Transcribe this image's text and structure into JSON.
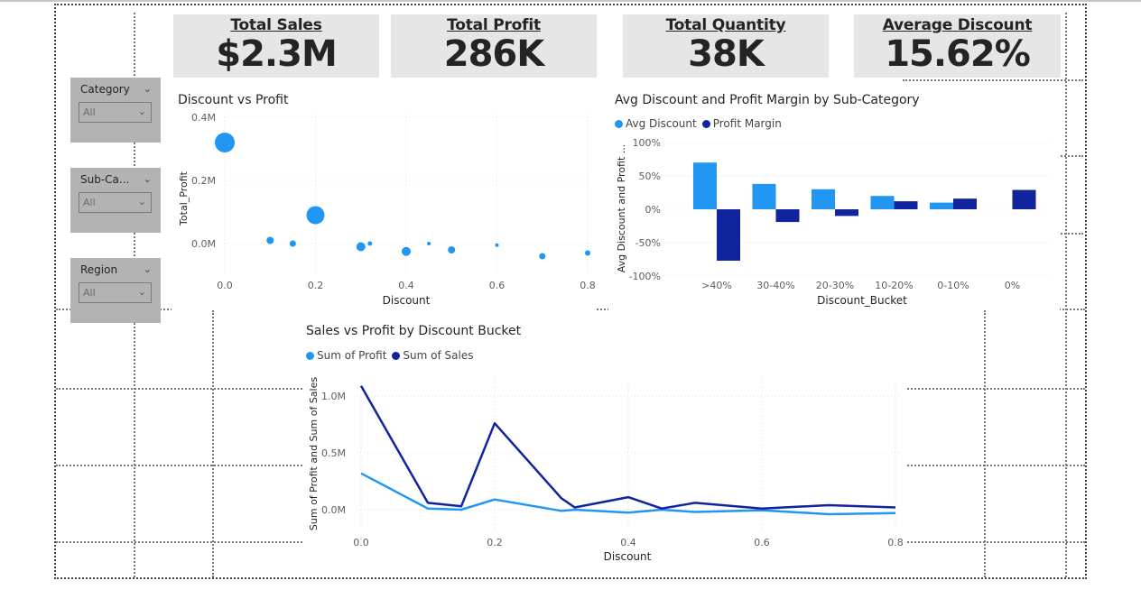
{
  "cards": [
    {
      "title": "Total Sales",
      "value": "$2.3M"
    },
    {
      "title": "Total Profit",
      "value": "286K"
    },
    {
      "title": "Total Quantity",
      "value": "38K"
    },
    {
      "title": "Average Discount",
      "value": "15.62%"
    }
  ],
  "slicers": [
    {
      "title": "Category",
      "value": "All"
    },
    {
      "title": "Sub-Ca...",
      "value": "All"
    },
    {
      "title": "Region",
      "value": "All"
    }
  ],
  "colors": {
    "light": "#2196f3",
    "dark": "#12239e",
    "card_bg": "#e6e6e6",
    "slicer_bg": "#b3b3b3"
  },
  "chart_data": [
    {
      "type": "scatter",
      "title": "Discount vs Profit",
      "xlabel": "Discount",
      "ylabel": "Total_Profit",
      "xlim": [
        0,
        0.8
      ],
      "ylim": [
        -0.05,
        0.4
      ],
      "x_ticks": [
        "0.0",
        "0.2",
        "0.4",
        "0.6",
        "0.8"
      ],
      "y_ticks": [
        "0.4M",
        "0.2M",
        "0.0M"
      ],
      "grid": true,
      "points": [
        {
          "x": 0.0,
          "y": 0.32,
          "size": 11
        },
        {
          "x": 0.1,
          "y": 0.01,
          "size": 4
        },
        {
          "x": 0.15,
          "y": 0.0,
          "size": 3.5
        },
        {
          "x": 0.2,
          "y": 0.09,
          "size": 10
        },
        {
          "x": 0.3,
          "y": -0.01,
          "size": 5
        },
        {
          "x": 0.32,
          "y": 0.0,
          "size": 2.5
        },
        {
          "x": 0.4,
          "y": -0.025,
          "size": 5
        },
        {
          "x": 0.45,
          "y": 0.0,
          "size": 2
        },
        {
          "x": 0.5,
          "y": -0.02,
          "size": 4
        },
        {
          "x": 0.6,
          "y": -0.005,
          "size": 2
        },
        {
          "x": 0.7,
          "y": -0.04,
          "size": 3.5
        },
        {
          "x": 0.8,
          "y": -0.03,
          "size": 3
        }
      ]
    },
    {
      "type": "bar",
      "title": "Avg Discount and Profit Margin by Sub-Category",
      "xlabel": "Discount_Bucket",
      "ylabel": "Avg Discount and Profit ...",
      "categories": [
        ">40%",
        "30-40%",
        "20-30%",
        "10-20%",
        "0-10%",
        "0%"
      ],
      "ylim": [
        -100,
        100
      ],
      "y_ticks": [
        "100%",
        "50%",
        "0%",
        "-50%",
        "-100%"
      ],
      "legend_position": "top-left",
      "series": [
        {
          "name": "Avg Discount",
          "values": [
            70,
            38,
            30,
            20,
            10,
            0
          ]
        },
        {
          "name": "Profit Margin",
          "values": [
            -77,
            -19,
            -10,
            12,
            16,
            29
          ]
        }
      ]
    },
    {
      "type": "line",
      "title": "Sales vs Profit by Discount Bucket",
      "xlabel": "Discount",
      "ylabel": "Sum of Profit and Sum of Sales",
      "xlim": [
        0,
        0.8
      ],
      "ylim": [
        -0.1,
        1.1
      ],
      "x_ticks": [
        "0.0",
        "0.2",
        "0.4",
        "0.6",
        "0.8"
      ],
      "y_ticks": [
        "1.0M",
        "0.5M",
        "0.0M"
      ],
      "legend_position": "top-left",
      "x": [
        0.0,
        0.1,
        0.15,
        0.2,
        0.3,
        0.32,
        0.4,
        0.45,
        0.5,
        0.6,
        0.7,
        0.8
      ],
      "series": [
        {
          "name": "Sum of Profit",
          "values": [
            0.32,
            0.01,
            0.0,
            0.09,
            -0.01,
            0.0,
            -0.025,
            0.0,
            -0.02,
            -0.005,
            -0.04,
            -0.03
          ]
        },
        {
          "name": "Sum of Sales",
          "values": [
            1.09,
            0.06,
            0.03,
            0.76,
            0.1,
            0.02,
            0.11,
            0.01,
            0.06,
            0.01,
            0.04,
            0.02
          ]
        }
      ]
    }
  ]
}
